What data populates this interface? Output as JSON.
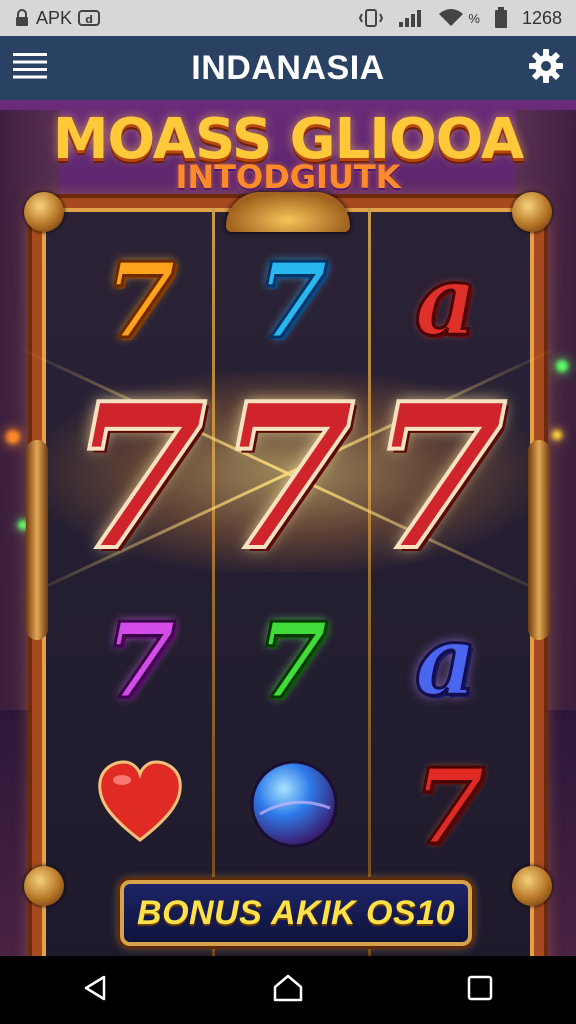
{
  "status_bar": {
    "left_label": "APK",
    "time": "1268",
    "percent_symbol": "%"
  },
  "app_bar": {
    "title": "INDANASIA",
    "menu_icon": "hamburger-menu-icon",
    "settings_icon": "gear-icon"
  },
  "game": {
    "logo_title": "MOASS GLIOOA",
    "logo_subtitle": "INTODGIUTK",
    "reels": {
      "top_row": [
        {
          "symbol": "7",
          "color": "#ffa21c"
        },
        {
          "symbol": "7",
          "color": "#29b7f0"
        },
        {
          "symbol": "a",
          "color": "#e0302a"
        }
      ],
      "win_row": [
        {
          "symbol": "7",
          "color": "#d0242c"
        },
        {
          "symbol": "7",
          "color": "#d0242c"
        },
        {
          "symbol": "7",
          "color": "#d0242c"
        }
      ],
      "row_3": [
        {
          "symbol": "7",
          "color": "#d34be8"
        },
        {
          "symbol": "7",
          "color": "#3fdc3a"
        },
        {
          "symbol": "a",
          "color": "#4a66f0"
        }
      ],
      "row_4": [
        {
          "symbol": "heart",
          "color": "#e02a24"
        },
        {
          "symbol": "orb",
          "color": "#2f7bea"
        },
        {
          "symbol": "7",
          "color": "#e02a24"
        }
      ]
    },
    "bonus_label": "BONUS AKIK OS10"
  },
  "nav_bar": {
    "back_icon": "back-triangle-icon",
    "home_icon": "home-icon",
    "recents_icon": "recents-square-icon"
  },
  "colors": {
    "app_bar": "#294264",
    "status_bar": "#d7d7d7",
    "frame": "#a74b1f",
    "bonus_text": "#ffe14a"
  }
}
